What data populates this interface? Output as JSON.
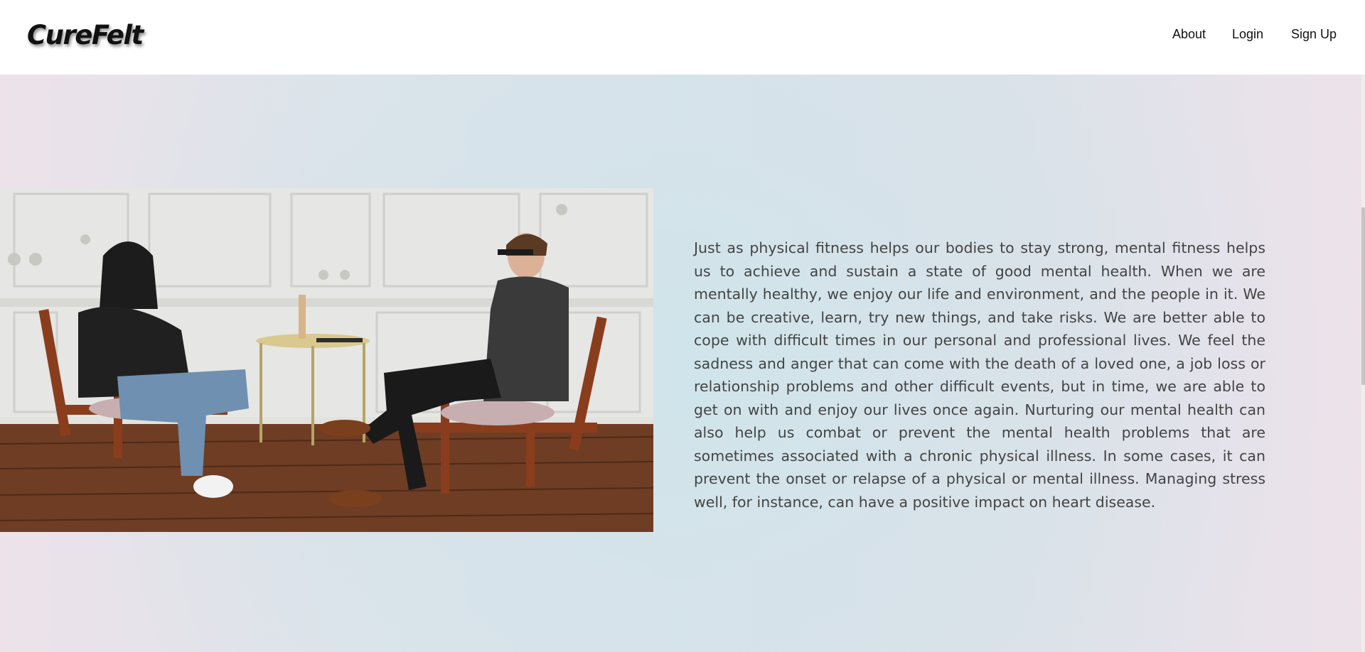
{
  "header": {
    "logo": "CureFelt",
    "nav": {
      "about": "About",
      "login": "Login",
      "signup": "Sign Up"
    }
  },
  "main": {
    "image": {
      "subject": "two men seated in wooden armchairs in a white-panelled room"
    },
    "paragraph": "Just as physical fitness helps our bodies to stay strong, mental fitness helps us to achieve and sustain a state of good mental health. When we are mentally healthy, we enjoy our life and environment, and the people in it. We can be creative, learn, try new things, and take risks. We are better able to cope with difficult times in our personal and professional lives. We feel the sadness and anger that can come with the death of a loved one, a job loss or relationship problems and other difficult events, but in time, we are able to get on with and enjoy our lives once again. Nurturing our mental health can also help us combat or prevent the mental health problems that are sometimes associated with a chronic physical illness. In some cases, it can prevent the onset or relapse of a physical or mental illness. Managing stress well, for instance, can have a positive impact on heart disease."
  },
  "colors": {
    "text": "#444444",
    "nav_text": "#111111",
    "header_bg": "#ffffff",
    "background_pink": "#ede2ea",
    "background_blue": "#d6e4ea"
  }
}
